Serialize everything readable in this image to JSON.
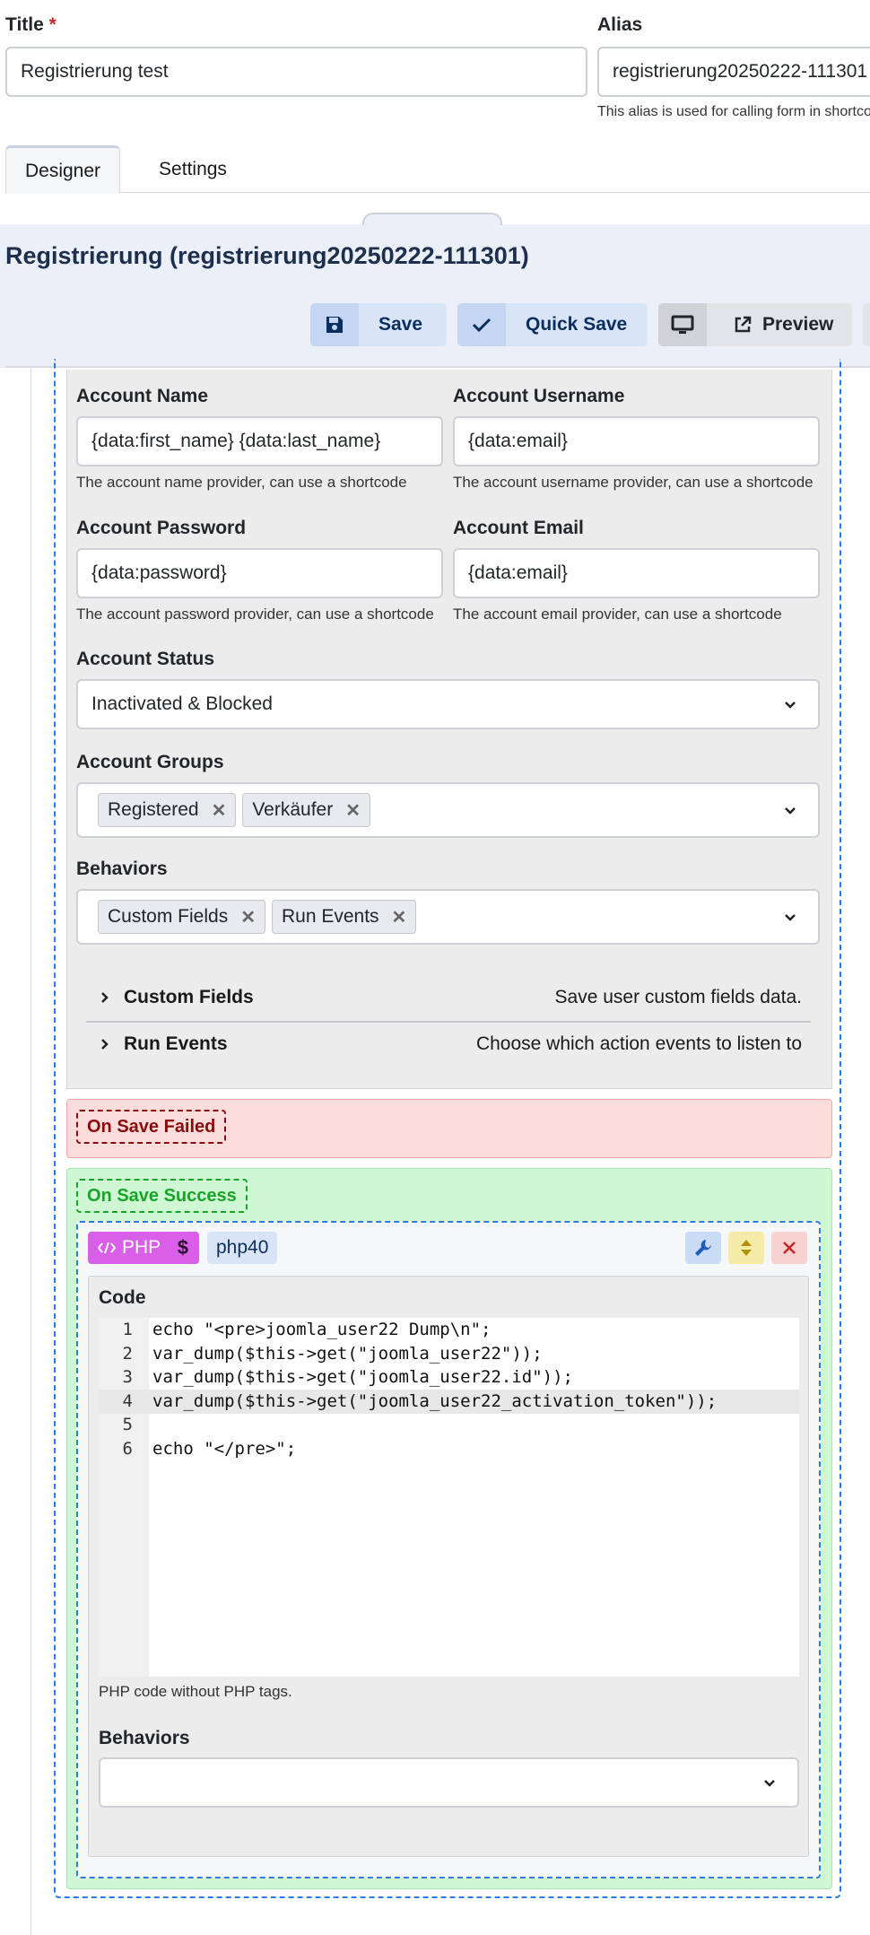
{
  "form": {
    "title_label": "Title",
    "required_marker": "*",
    "title_value": "Registrierung test",
    "alias_label": "Alias",
    "alias_value": "registrierung20250222-111301",
    "alias_help": "This alias is used for calling form in shortcodes"
  },
  "tabs": [
    {
      "label": "Designer",
      "active": true
    },
    {
      "label": "Settings",
      "active": false
    }
  ],
  "designer": {
    "heading": "Registrierung (registrierung20250222-111301)",
    "toolbar": {
      "save": "Save",
      "quick_save": "Quick Save",
      "preview": "Preview"
    }
  },
  "account": {
    "name_label": "Account Name",
    "name_value": "{data:first_name} {data:last_name}",
    "name_help": "The account name provider, can use a shortcode",
    "username_label": "Account Username",
    "username_value": "{data:email}",
    "username_help": "The account username provider, can use a shortcode",
    "password_label": "Account Password",
    "password_value": "{data:password}",
    "password_help": "The account password provider, can use a shortcode",
    "email_label": "Account Email",
    "email_value": "{data:email}",
    "email_help": "The account email provider, can use a shortcode",
    "status_label": "Account Status",
    "status_value": "Inactivated & Blocked",
    "groups_label": "Account Groups",
    "groups": [
      "Registered",
      "Verkäufer"
    ],
    "behaviors_label": "Behaviors",
    "behaviors": [
      "Custom Fields",
      "Run Events"
    ],
    "accordions": [
      {
        "title": "Custom Fields",
        "desc": "Save user custom fields data."
      },
      {
        "title": "Run Events",
        "desc": "Choose which action events to listen to"
      }
    ]
  },
  "events": {
    "failed_label": "On Save Failed",
    "success_label": "On Save Success"
  },
  "php_block": {
    "type_badge": "PHP",
    "name_badge": "php40",
    "code_label": "Code",
    "lines": [
      {
        "n": "1",
        "text": "echo \"<pre>joomla_user22 Dump\\n\";"
      },
      {
        "n": "2",
        "text": "var_dump($this->get(\"joomla_user22\"));"
      },
      {
        "n": "3",
        "text": "var_dump($this->get(\"joomla_user22.id\"));"
      },
      {
        "n": "4",
        "text": "var_dump($this->get(\"joomla_user22_activation_token\"));"
      },
      {
        "n": "5",
        "text": ""
      },
      {
        "n": "6",
        "text": "echo \"</pre>\";"
      }
    ],
    "active_line": 4,
    "code_help": "PHP code without PHP tags.",
    "behaviors_label": "Behaviors",
    "behaviors_value": ""
  },
  "colors": {
    "accent_blue": "#0a2f5f",
    "failed_bg": "#fddcdc",
    "failed_text": "#8b0b0b",
    "success_bg": "#cff7d3",
    "success_text": "#17a527",
    "php_badge": "#d95ee8"
  },
  "icons": [
    "floppy-disk-icon",
    "check-icon",
    "monitor-icon",
    "external-link-icon",
    "chevron-down-icon",
    "chevron-right-icon",
    "close-x-icon",
    "code-icon",
    "dollar-icon",
    "wrench-icon",
    "sort-icon"
  ]
}
